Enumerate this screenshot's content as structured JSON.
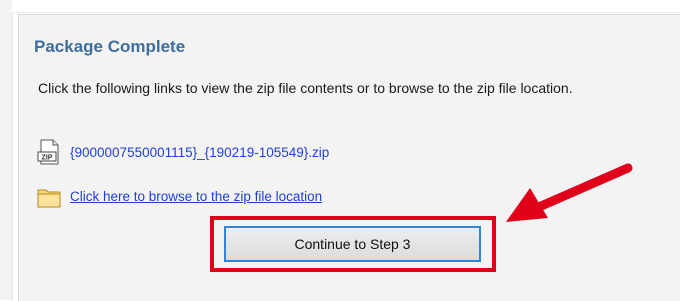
{
  "dialog": {
    "title": "Package Complete",
    "description": "Click the following links to view the zip file contents or to browse to the zip file location.",
    "zip_link": "{9000007550001115}_{190219-105549}.zip",
    "zip_icon": "zip-file-icon",
    "zip_icon_label": "ZIP",
    "folder_link": "Click here to browse to the zip file location",
    "folder_icon": "folder-icon",
    "continue_button": "Continue to Step 3"
  },
  "annotations": {
    "highlight_color": "#e0001a",
    "arrow_icon": "red-arrow-icon"
  },
  "colors": {
    "title": "#3f6e9c",
    "link": "#1f3fd6",
    "button_border": "#2f86d6",
    "panel_bg": "#f3f3f3"
  }
}
